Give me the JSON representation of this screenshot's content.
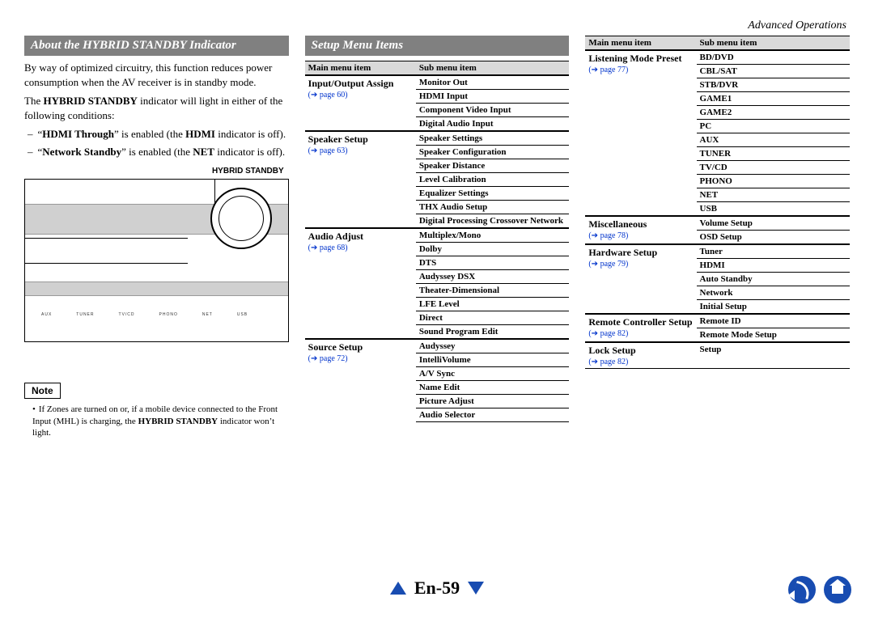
{
  "header": {
    "section": "Advanced Operations"
  },
  "left": {
    "title": "About the HYBRID STANDBY Indicator",
    "intro": "By way of optimized circuitry, this function reduces power consumption when the AV receiver is in standby mode.",
    "line2_pre": "The ",
    "line2_bold": "HYBRID STANDBY",
    "line2_post": " indicator will light in either of the following conditions:",
    "bullets": [
      {
        "q1": "“",
        "b1": "HDMI Through",
        "post1": "” is enabled (the ",
        "b2": "HDMI",
        "post2": " indicator is off)."
      },
      {
        "q1": "“",
        "b1": "Network Standby",
        "post1": "” is enabled (the ",
        "b2": "NET",
        "post2": " indicator is off)."
      }
    ],
    "label": "HYBRID STANDBY",
    "note_label": "Note",
    "note_pre": "If Zones are turned on or, if a mobile device connected to the Front Input (MHL) is charging, the ",
    "note_bold": "HYBRID STANDBY",
    "note_post": " indicator won’t light."
  },
  "middle": {
    "title": "Setup Menu Items",
    "th1": "Main menu item",
    "th2": "Sub menu item",
    "rows": [
      {
        "main": "Input/Output Assign",
        "page": "page 60",
        "subs": [
          "Monitor Out",
          "HDMI Input",
          "Component Video Input",
          "Digital Audio Input"
        ]
      },
      {
        "main": "Speaker Setup",
        "page": "page 63",
        "subs": [
          "Speaker Settings",
          "Speaker Configuration",
          "Speaker Distance",
          "Level Calibration",
          "Equalizer Settings",
          "THX Audio Setup",
          "Digital Processing Crossover Network"
        ]
      },
      {
        "main": "Audio Adjust",
        "page": "page 68",
        "subs": [
          "Multiplex/Mono",
          "Dolby",
          "DTS",
          "Audyssey DSX",
          "Theater-Dimensional",
          "LFE Level",
          "Direct",
          "Sound Program Edit"
        ]
      },
      {
        "main": "Source Setup",
        "page": "page 72",
        "subs": [
          "Audyssey",
          "IntelliVolume",
          "A/V Sync",
          "Name Edit",
          "Picture Adjust",
          "Audio Selector"
        ]
      }
    ]
  },
  "right": {
    "th1": "Main menu item",
    "th2": "Sub menu item",
    "rows": [
      {
        "main": "Listening Mode Preset",
        "page": "page 77",
        "subs": [
          "BD/DVD",
          "CBL/SAT",
          "STB/DVR",
          "GAME1",
          "GAME2",
          "PC",
          "AUX",
          "TUNER",
          "TV/CD",
          "PHONO",
          "NET",
          "USB"
        ]
      },
      {
        "main": "Miscellaneous",
        "page": "page 78",
        "subs": [
          "Volume Setup",
          "OSD Setup"
        ]
      },
      {
        "main": "Hardware Setup",
        "page": "page 79",
        "subs": [
          "Tuner",
          "HDMI",
          "Auto Standby",
          "Network",
          "Initial Setup"
        ]
      },
      {
        "main": "Remote Controller Setup",
        "page": "page 82",
        "subs": [
          "Remote ID",
          "Remote Mode Setup"
        ]
      },
      {
        "main": "Lock Setup",
        "page": "page 82",
        "subs": [
          "Setup"
        ]
      }
    ]
  },
  "footer": {
    "page": "En-59"
  }
}
